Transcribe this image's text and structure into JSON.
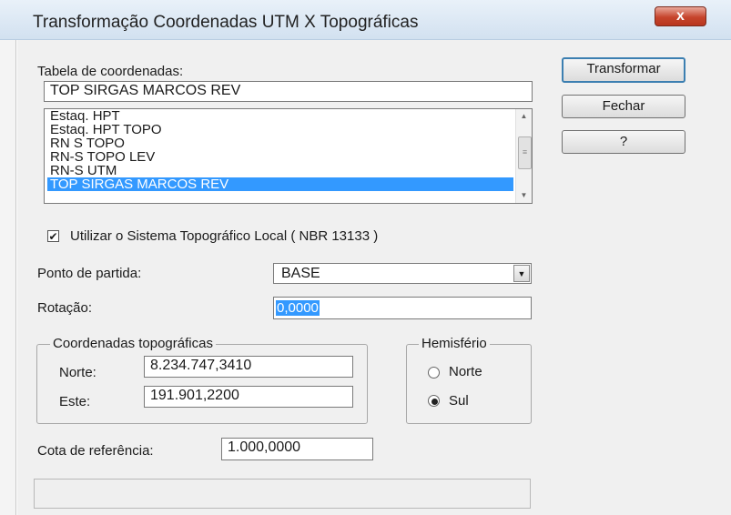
{
  "window": {
    "title": "Transformação Coordenadas UTM X Topográficas",
    "close_label": "x"
  },
  "table": {
    "label": "Tabela de coordenadas:",
    "value": "TOP SIRGAS MARCOS REV",
    "items": [
      {
        "label": "Estaq. HPT",
        "selected": false
      },
      {
        "label": "Estaq. HPT TOPO",
        "selected": false
      },
      {
        "label": "RN S TOPO",
        "selected": false
      },
      {
        "label": "RN-S TOPO LEV",
        "selected": false
      },
      {
        "label": "RN-S UTM",
        "selected": false
      },
      {
        "label": "TOP SIRGAS MARCOS REV",
        "selected": true
      }
    ]
  },
  "buttons": {
    "transformar": "Transformar",
    "fechar": "Fechar",
    "help": "?"
  },
  "local_system": {
    "checked": true,
    "label": "Utilizar o Sistema Topográfico Local ( NBR 13133 )"
  },
  "start_point": {
    "label": "Ponto de partida:",
    "value": "BASE"
  },
  "rotation": {
    "label": "Rotação:",
    "value": "0,0000"
  },
  "topo_coords": {
    "title": "Coordenadas topográficas",
    "north_label": "Norte:",
    "north_value": "8.234.747,3410",
    "east_label": "Este:",
    "east_value": "191.901,2200"
  },
  "hemisphere": {
    "title": "Hemisfério",
    "options": [
      {
        "label": "Norte",
        "selected": false
      },
      {
        "label": "Sul",
        "selected": true
      }
    ]
  },
  "reference_elevation": {
    "label": "Cota de referência:",
    "value": "1.000,0000"
  }
}
